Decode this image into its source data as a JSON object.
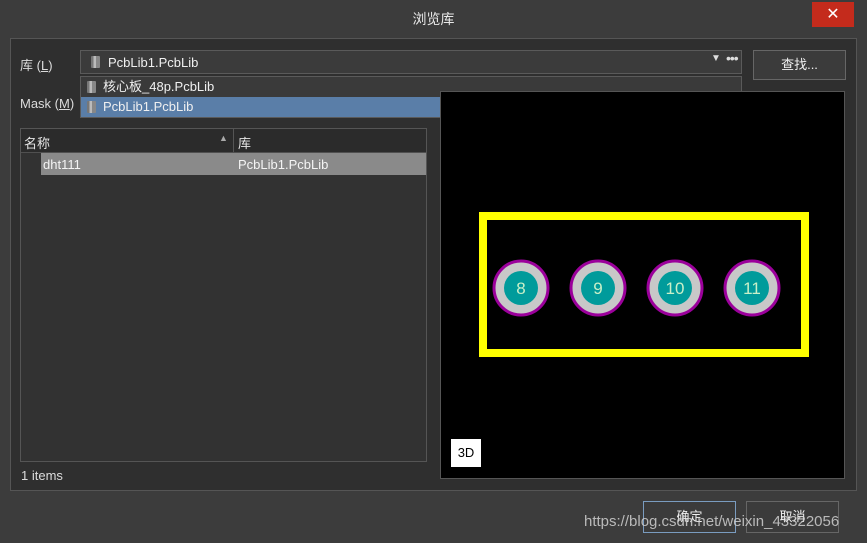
{
  "dialog": {
    "title": "浏览库",
    "close_glyph": "✕"
  },
  "library": {
    "label_prefix": "库 (",
    "label_key": "L",
    "label_suffix": ")",
    "selected": "PcbLib1.PcbLib",
    "more_glyph": "•••",
    "arrow_glyph": "▼"
  },
  "dropdown": {
    "items": [
      "核心板_48p.PcbLib",
      "PcbLib1.PcbLib"
    ],
    "highlighted_index": 1
  },
  "find_button": "查找...",
  "mask": {
    "label_prefix": "Mask (",
    "label_key": "M",
    "label_suffix": ")"
  },
  "table": {
    "columns": [
      "名称",
      "库"
    ],
    "sort_glyph": "▲",
    "rows": [
      {
        "name": "dht111",
        "library": "PcbLib1.PcbLib"
      }
    ]
  },
  "item_count": "1 items",
  "preview": {
    "button_3d": "3D",
    "pads": [
      "8",
      "9",
      "10",
      "11"
    ],
    "colors": {
      "outline": "#ffff00",
      "pad_ring": "#9b009b",
      "pad_fill": "#c8c8c8",
      "hole": "#009b9b",
      "background": "#000000"
    }
  },
  "buttons": {
    "ok": "确定",
    "cancel": "取消"
  },
  "watermark": "https://blog.csdn.net/weixin_43322056"
}
